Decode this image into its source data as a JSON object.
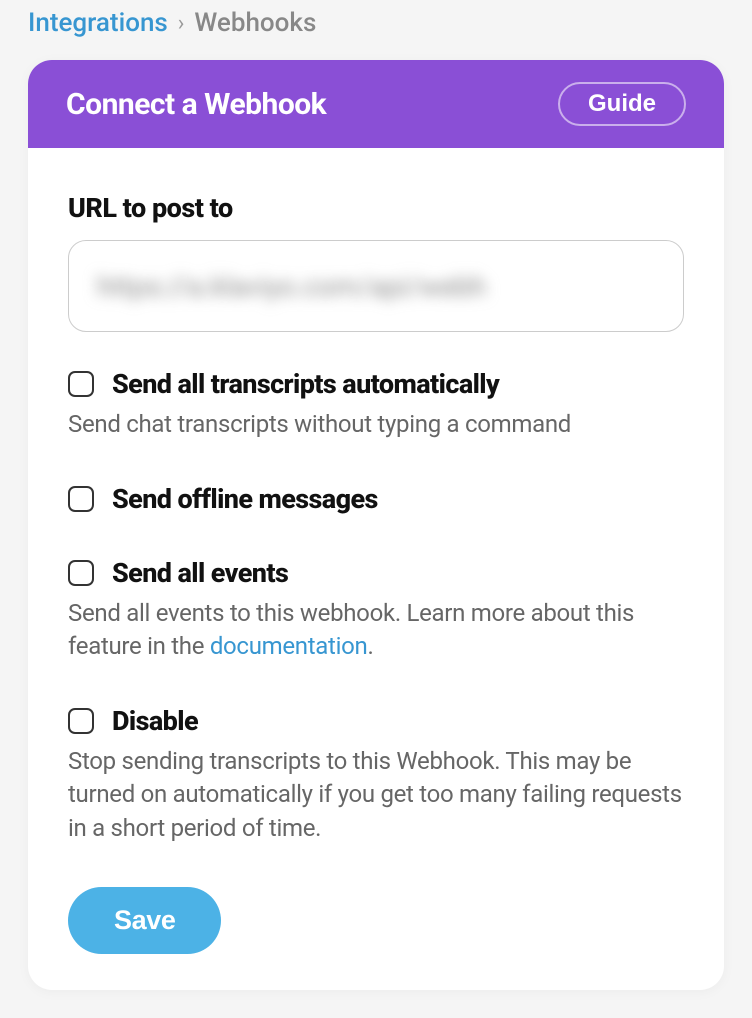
{
  "breadcrumb": {
    "parent": "Integrations",
    "separator": "›",
    "current": "Webhooks"
  },
  "header": {
    "title": "Connect a Webhook",
    "guide_label": "Guide"
  },
  "form": {
    "url_label": "URL to post to",
    "url_value": "https://a.klaviyo.com/api/webh",
    "options": [
      {
        "title": "Send all transcripts automatically",
        "desc": "Send chat transcripts without typing a command"
      },
      {
        "title": "Send offline messages",
        "desc": ""
      },
      {
        "title": "Send all events",
        "desc_prefix": "Send all events to this webhook. Learn more about this feature in the ",
        "desc_link": "documentation",
        "desc_suffix": "."
      },
      {
        "title": "Disable",
        "desc": "Stop sending transcripts to this Webhook. This may be turned on automatically if you get too many failing requests in a short period of time."
      }
    ],
    "save_label": "Save"
  }
}
